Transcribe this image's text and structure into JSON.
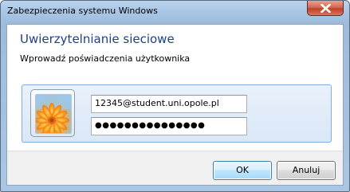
{
  "window": {
    "title": "Zabezpieczenia systemu Windows"
  },
  "dialog": {
    "heading": "Uwierzytelnianie sieciowe",
    "subheading": "Wprowadź poświadczenia użytkownika"
  },
  "credentials": {
    "username": "12345@student.uni.opole.pl",
    "password_masked": "●●●●●●●●●●●●●●●"
  },
  "buttons": {
    "ok": "OK",
    "cancel": "Anuluj"
  },
  "icons": {
    "close": "close-icon",
    "avatar": "user-avatar-flower"
  },
  "colors": {
    "heading": "#1e3f87",
    "close_button": "#c0412a",
    "default_button_border": "#3c7fb1"
  }
}
